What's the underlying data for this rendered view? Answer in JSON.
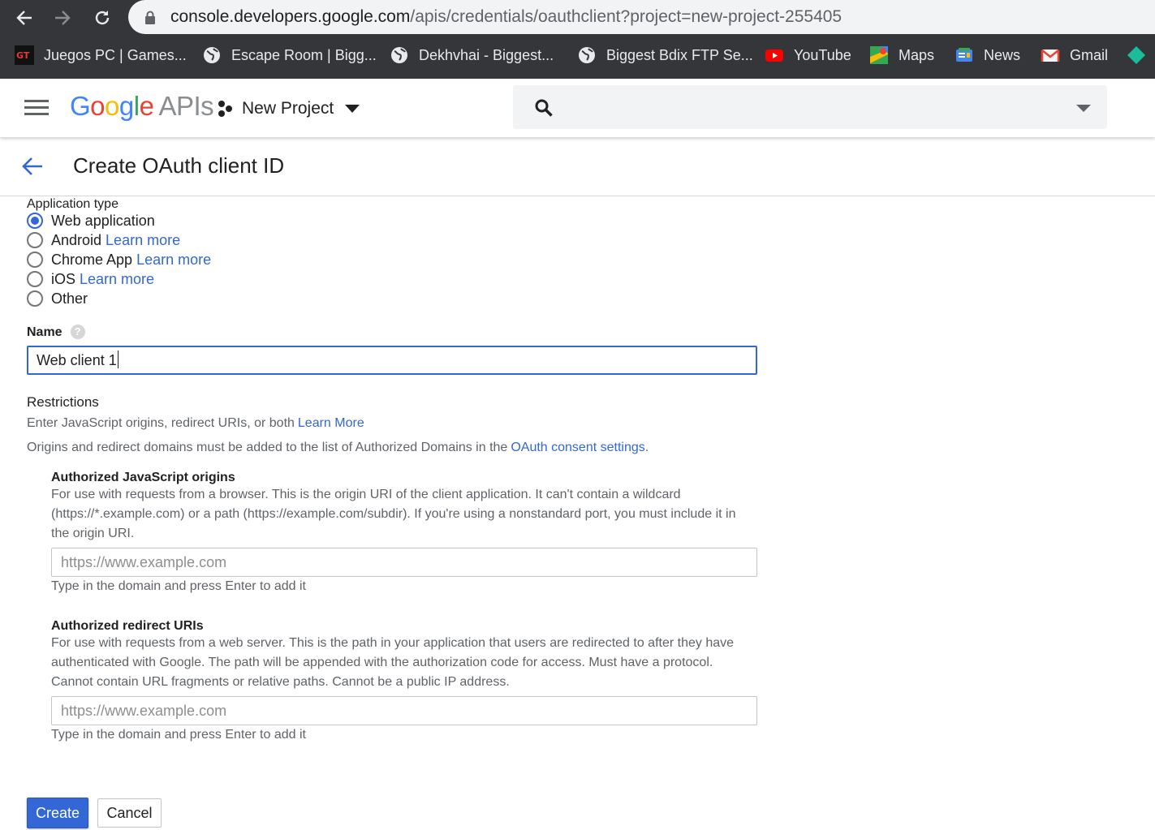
{
  "browser": {
    "url_host": "console.developers.google.com",
    "url_path": "/apis/credentials/oauthclient?project=new-project-255405",
    "bookmarks": [
      {
        "label": "Juegos PC | Games...",
        "icon": "gt-games-icon"
      },
      {
        "label": "Escape Room | Bigg...",
        "icon": "globe-icon"
      },
      {
        "label": "Dekhvhai - Biggest...",
        "icon": "globe-icon"
      },
      {
        "label": "Biggest Bdix FTP Se...",
        "icon": "globe-icon"
      },
      {
        "label": "YouTube",
        "icon": "youtube-icon"
      },
      {
        "label": "Maps",
        "icon": "maps-icon"
      },
      {
        "label": "News",
        "icon": "news-icon"
      },
      {
        "label": "Gmail",
        "icon": "gmail-icon"
      }
    ]
  },
  "header": {
    "logo_google": [
      "G",
      "o",
      "o",
      "g",
      "l",
      "e"
    ],
    "logo_google_colors": [
      "#4285f4",
      "#ea4335",
      "#fbbc05",
      "#4285f4",
      "#34a853",
      "#ea4335"
    ],
    "logo_apis": "APIs",
    "project_name": "New Project"
  },
  "page": {
    "title": "Create OAuth client ID"
  },
  "form": {
    "application_type_label": "Application type",
    "options": [
      {
        "label": "Web application",
        "link": "",
        "selected": true
      },
      {
        "label": "Android",
        "link": "Learn more",
        "selected": false
      },
      {
        "label": "Chrome App",
        "link": "Learn more",
        "selected": false
      },
      {
        "label": "iOS",
        "link": "Learn more",
        "selected": false
      },
      {
        "label": "Other",
        "link": "",
        "selected": false
      }
    ],
    "name_label": "Name",
    "name_value": "Web client 1",
    "restrictions_title": "Restrictions",
    "restrictions_text": "Enter JavaScript origins, redirect URIs, or both",
    "restrictions_link": "Learn More",
    "domains_text": "Origins and redirect domains must be added to the list of Authorized Domains in the",
    "domains_link": "OAuth consent settings",
    "domains_period": ".",
    "js_origins": {
      "title": "Authorized JavaScript origins",
      "description": "For use with requests from a browser. This is the origin URI of the client application. It can't contain a wildcard (https://*.example.com) or a path (https://example.com/subdir). If you're using a nonstandard port, you must include it in the origin URI.",
      "placeholder": "https://www.example.com",
      "hint": "Type in the domain and press Enter to add it"
    },
    "redirect_uris": {
      "title": "Authorized redirect URIs",
      "description": "For use with requests from a web server. This is the path in your application that users are redirected to after they have authenticated with Google. The path will be appended with the authorization code for access. Must have a protocol. Cannot contain URL fragments or relative paths. Cannot be a public IP address.",
      "placeholder": "https://www.example.com",
      "hint": "Type in the domain and press Enter to add it"
    },
    "create_label": "Create",
    "cancel_label": "Cancel"
  },
  "colors": {
    "accent": "#3367d6",
    "browser_chrome": "#35363a"
  }
}
